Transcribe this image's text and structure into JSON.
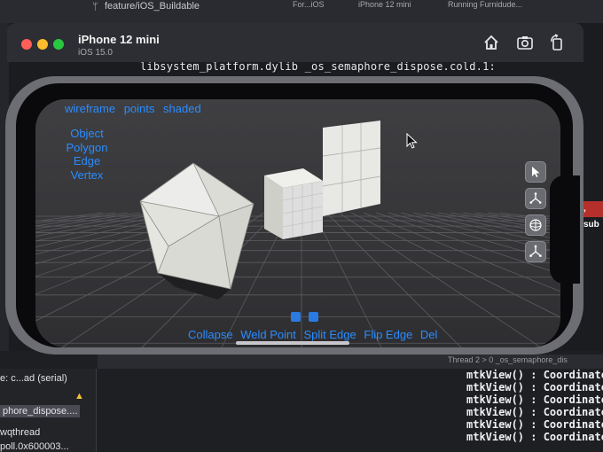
{
  "xcode": {
    "branch": "feature/iOS_Buildable",
    "tabs": [
      "For...iOS",
      "iPhone 12 mini",
      "Running Furnidude..."
    ],
    "code_line": "libsystem_platform.dylib _os_semaphore_dispose.cold.1:",
    "side_badge": ", sub",
    "thread_label": "Thread 2 > 0 _os_semaphore_dis",
    "left_panel": [
      "e: c...ad (serial)",
      "phore_dispose....",
      "wqthread",
      "poll.0x600003..."
    ],
    "console_lines": [
      "mtkView() : Coordinato",
      "mtkView() : Coordinato",
      "mtkView() : Coordinato",
      "mtkView() : Coordinato",
      "mtkView() : Coordinato",
      "mtkView() : Coordinato"
    ]
  },
  "simulator": {
    "device_name": "iPhone 12 mini",
    "os_version": "iOS 15.0",
    "toolbar_icons": [
      "home-icon",
      "screenshot-icon",
      "rotate-icon"
    ]
  },
  "app": {
    "render_modes": [
      "wireframe",
      "points",
      "shaded"
    ],
    "selection_modes": [
      "Object",
      "Polygon",
      "Edge",
      "Vertex"
    ],
    "tool_icons": [
      "pointer-icon",
      "move-icon",
      "rotate-gizmo-icon",
      "scale-icon"
    ],
    "actions": [
      "Collapse",
      "Weld Point",
      "Split Edge",
      "Flip Edge",
      "Del"
    ],
    "accent_color": "#2a8cff"
  }
}
